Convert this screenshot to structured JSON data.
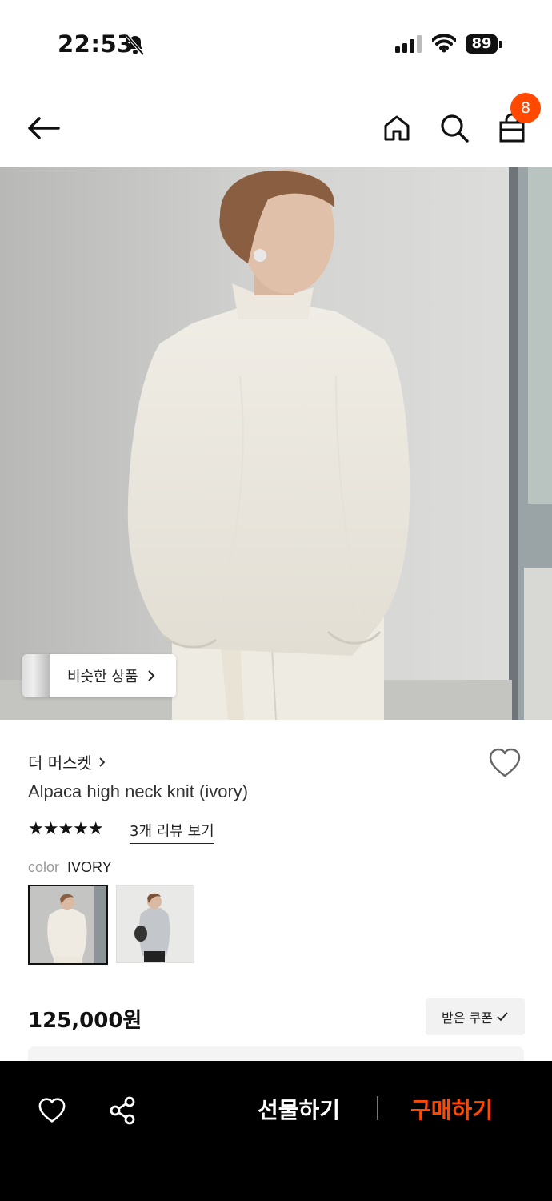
{
  "status_bar": {
    "time": "22:53",
    "battery": "89"
  },
  "nav": {
    "cart_count": "8"
  },
  "similar_button": {
    "label": "비슷한 상품"
  },
  "product": {
    "brand": "더 머스켓",
    "name": "Alpaca high neck knit (ivory)",
    "rating_stars": "★★★★★",
    "reviews_link": "3개 리뷰 보기",
    "color_label": "color",
    "color_value": "IVORY",
    "price": "125,000원",
    "coupon_label": "받은 쿠폰"
  },
  "bottom_bar": {
    "gift_label": "선물하기",
    "buy_label": "구매하기"
  },
  "colors": {
    "accent": "#ff4800",
    "bar": "#000000"
  }
}
